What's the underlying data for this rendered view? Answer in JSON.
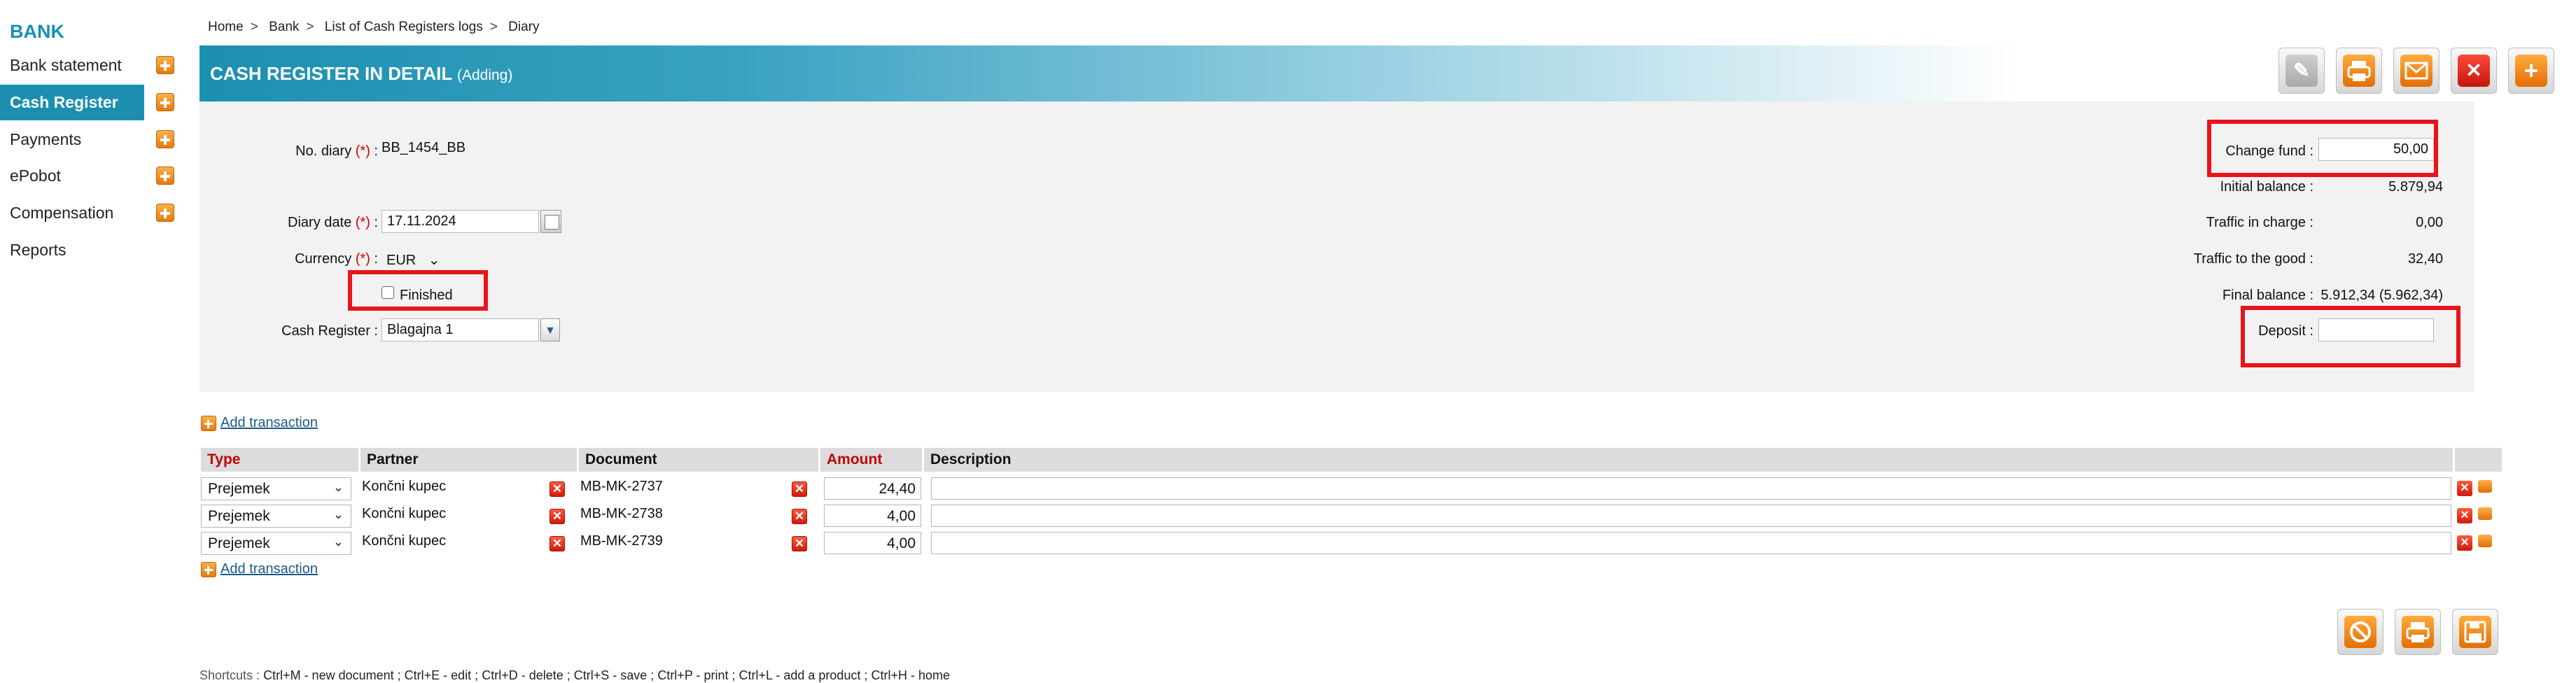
{
  "sidebar": {
    "brand": "BANK",
    "items": [
      {
        "label": "Bank statement",
        "has_add": true
      },
      {
        "label": "Cash Register",
        "has_add": true,
        "active": true
      },
      {
        "label": "Payments",
        "has_add": true
      },
      {
        "label": "ePobot",
        "has_add": true
      },
      {
        "label": "Compensation",
        "has_add": true
      },
      {
        "label": "Reports",
        "has_add": false
      }
    ]
  },
  "breadcrumb": [
    "Home",
    "Bank",
    "List of Cash Registers logs",
    "Diary"
  ],
  "header": {
    "title": "CASH REGISTER IN DETAIL",
    "subtitle": "(Adding)",
    "toolbar": [
      {
        "name": "edit-button",
        "icon": "pencil-icon"
      },
      {
        "name": "print-button",
        "icon": "printer-icon"
      },
      {
        "name": "email-button",
        "icon": "envelope-icon"
      },
      {
        "name": "delete-button",
        "icon": "close-icon"
      },
      {
        "name": "add-button",
        "icon": "plus-icon"
      }
    ]
  },
  "form": {
    "no_diary_label": "No. diary",
    "no_diary_value": "BB_1454_BB",
    "required_mark": "(*)",
    "diary_date_label": "Diary date",
    "diary_date_value": "17.11.2024",
    "currency_label": "Currency",
    "currency_value": "EUR",
    "finished_label": "Finished",
    "cash_register_label": "Cash Register :",
    "cash_register_value": "Blagajna 1",
    "change_fund_label": "Change fund :",
    "change_fund_value": "50,00",
    "initial_balance_label": "Initial balance :",
    "initial_balance_value": "5.879,94",
    "traffic_charge_label": "Traffic in charge :",
    "traffic_charge_value": "0,00",
    "traffic_good_label": "Traffic to the good :",
    "traffic_good_value": "32,40",
    "final_balance_label": "Final balance :",
    "final_balance_value": "5.912,34 (5.962,34)",
    "deposit_label": "Deposit :",
    "deposit_value": ""
  },
  "transactions": {
    "add_label": "Add transaction",
    "columns": [
      "Type",
      "Partner",
      "Document",
      "Amount",
      "Description"
    ],
    "rows": [
      {
        "type": "Prejemek",
        "partner": "Končni kupec",
        "document": "MB-MK-2737",
        "amount": "24,40",
        "description": ""
      },
      {
        "type": "Prejemek",
        "partner": "Končni kupec",
        "document": "MB-MK-2738",
        "amount": "4,00",
        "description": ""
      },
      {
        "type": "Prejemek",
        "partner": "Končni kupec",
        "document": "MB-MK-2739",
        "amount": "4,00",
        "description": ""
      }
    ]
  },
  "shortcuts": {
    "label": "Shortcuts :",
    "items": [
      "Ctrl+M - new document ;",
      "Ctrl+E - edit ;",
      "Ctrl+D - delete ;",
      "Ctrl+S - save ;",
      "Ctrl+P - print ;",
      "Ctrl+L - add a product ;",
      "Ctrl+H - home"
    ]
  },
  "colors": {
    "accent": "#1c8fb0",
    "highlight": "#e8141b",
    "required": "#d40000",
    "button_orange": "#e67a10"
  }
}
